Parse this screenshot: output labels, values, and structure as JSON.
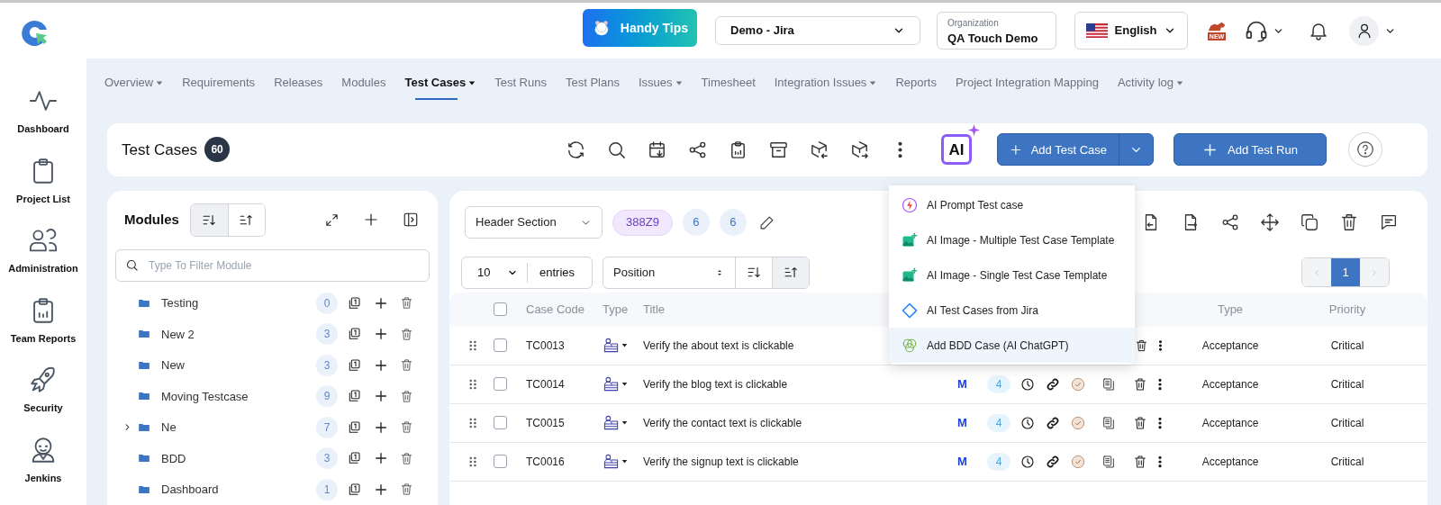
{
  "topbar": {
    "handy_tips": "Handy Tips",
    "project": "Demo - Jira",
    "organization": {
      "label": "Organization",
      "value": "QA Touch Demo"
    },
    "language": "English",
    "new_badge": "NEW"
  },
  "sidebar": [
    {
      "label": "Dashboard",
      "kind": "pulse"
    },
    {
      "label": "Project List",
      "kind": "clipboard"
    },
    {
      "label": "Administration",
      "kind": "users"
    },
    {
      "label": "Team Reports",
      "kind": "report"
    },
    {
      "label": "Security",
      "kind": "rocket"
    },
    {
      "label": "Jenkins",
      "kind": "butler"
    }
  ],
  "nav": [
    {
      "label": "Overview",
      "dropdown": true,
      "selected": false
    },
    {
      "label": "Requirements",
      "dropdown": false,
      "selected": false
    },
    {
      "label": "Releases",
      "dropdown": false,
      "selected": false
    },
    {
      "label": "Modules",
      "dropdown": false,
      "selected": false
    },
    {
      "label": "Test Cases",
      "dropdown": true,
      "selected": true
    },
    {
      "label": "Test Runs",
      "dropdown": false,
      "selected": false
    },
    {
      "label": "Test Plans",
      "dropdown": false,
      "selected": false
    },
    {
      "label": "Issues",
      "dropdown": true,
      "selected": false
    },
    {
      "label": "Timesheet",
      "dropdown": false,
      "selected": false
    },
    {
      "label": "Integration Issues",
      "dropdown": true,
      "selected": false
    },
    {
      "label": "Reports",
      "dropdown": false,
      "selected": false
    },
    {
      "label": "Project Integration Mapping",
      "dropdown": false,
      "selected": false
    },
    {
      "label": "Activity log",
      "dropdown": true,
      "selected": false
    }
  ],
  "header": {
    "title": "Test Cases",
    "count": "60",
    "ai_label": "AI",
    "add_test_case": "Add Test Case",
    "add_test_run": "Add Test Run"
  },
  "modules": {
    "title": "Modules",
    "sort": [
      {
        "kind": "desc",
        "selected": true
      },
      {
        "kind": "asc",
        "selected": false
      }
    ],
    "filter_placeholder": "Type To Filter Module",
    "items": [
      {
        "name": "Testing",
        "count": "0",
        "has_children": false
      },
      {
        "name": "New 2",
        "count": "3",
        "has_children": false
      },
      {
        "name": "New",
        "count": "3",
        "has_children": false
      },
      {
        "name": "Moving Testcase",
        "count": "9",
        "has_children": false
      },
      {
        "name": "Ne",
        "count": "7",
        "has_children": true
      },
      {
        "name": "BDD",
        "count": "3",
        "has_children": false
      },
      {
        "name": "Dashboard",
        "count": "1",
        "has_children": false
      }
    ]
  },
  "cases": {
    "section": "Header Section",
    "tags": [
      {
        "label": "388Z9",
        "kind": "code"
      },
      {
        "label": "6",
        "kind": "count"
      },
      {
        "label": "6",
        "kind": "count"
      }
    ],
    "select_all_checked": false,
    "page_size": "10",
    "entries_label": "entries",
    "sort_field": "Position",
    "sort": [
      {
        "kind": "desc",
        "selected": false
      },
      {
        "kind": "asc",
        "selected": true
      }
    ],
    "page": "1",
    "columns": [
      "Case Code",
      "Type",
      "Title",
      "Type",
      "Priority"
    ],
    "rows": [
      {
        "code": "TC0013",
        "title": "Verify the about text is clickable",
        "type": "Acceptance",
        "priority": "Critical",
        "checked": false
      },
      {
        "code": "TC0014",
        "title": "Verify the blog text is clickable",
        "mark": "M",
        "count": "4",
        "type": "Acceptance",
        "priority": "Critical",
        "checked": false
      },
      {
        "code": "TC0015",
        "title": "Verify the contact text is clickable",
        "mark": "M",
        "count": "4",
        "type": "Acceptance",
        "priority": "Critical",
        "checked": false
      },
      {
        "code": "TC0016",
        "title": "Verify the signup text is clickable",
        "mark": "M",
        "count": "4",
        "type": "Acceptance",
        "priority": "Critical",
        "checked": false
      }
    ]
  },
  "menu": [
    {
      "label": "AI Prompt Test case",
      "kind": "prompt",
      "selected": false
    },
    {
      "label": "AI Image - Multiple Test Case Template",
      "kind": "image",
      "selected": false
    },
    {
      "label": "AI Image - Single Test Case Template",
      "kind": "image",
      "selected": false
    },
    {
      "label": "AI Test Cases from Jira",
      "kind": "jira",
      "selected": false
    },
    {
      "label": "Add BDD Case (AI ChatGPT)",
      "kind": "bdd",
      "selected": true
    }
  ]
}
